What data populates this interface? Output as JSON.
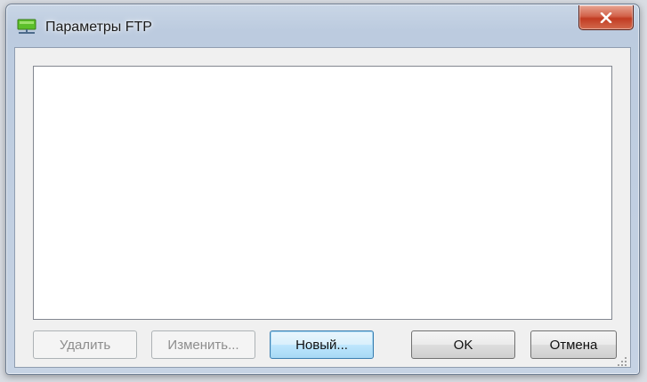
{
  "window": {
    "title": "Параметры FTP",
    "icon": "network-drive-icon"
  },
  "buttons": {
    "delete_label": "Удалить",
    "edit_label": "Изменить...",
    "new_label": "Новый...",
    "ok_label": "OK",
    "cancel_label": "Отмена"
  },
  "colors": {
    "icon_green": "#5cbf2a",
    "close_red": "#c13b22",
    "focus_blue": "#3c7fb1"
  }
}
